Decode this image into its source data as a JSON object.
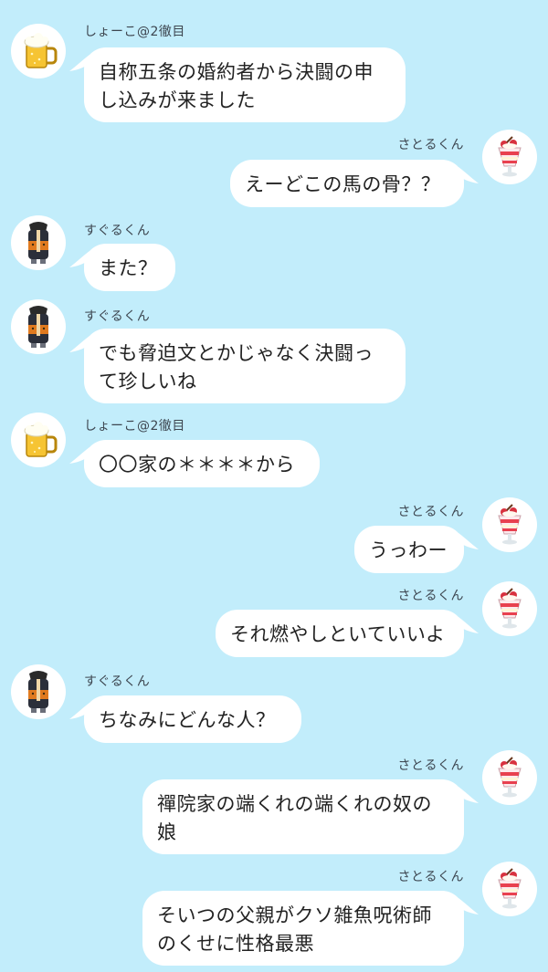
{
  "colors": {
    "background": "#c2edfb",
    "bubble": "#ffffff",
    "text": "#222222",
    "name": "#3d4650"
  },
  "users": {
    "shoko": {
      "name": "しょーこ@2徹目",
      "avatar_icon": "beer-mug-icon"
    },
    "satoru": {
      "name": "さとるくん",
      "avatar_icon": "parfait-icon"
    },
    "suguru": {
      "name": "すぐるくん",
      "avatar_icon": "monk-icon"
    }
  },
  "messages": [
    {
      "user": "shoko",
      "side": "left",
      "text": "自称五条の婚約者から決闘の申\nし込みが来ました"
    },
    {
      "user": "satoru",
      "side": "right",
      "text": "えーどこの馬の骨？？"
    },
    {
      "user": "suguru",
      "side": "left",
      "text": "また？"
    },
    {
      "user": "suguru",
      "side": "left",
      "text": "でも脅迫文とかじゃなく決闘っ\nて珍しいね"
    },
    {
      "user": "shoko",
      "side": "left",
      "text": "〇〇家の＊＊＊＊から"
    },
    {
      "user": "satoru",
      "side": "right",
      "text": "うっわー"
    },
    {
      "user": "satoru",
      "side": "right",
      "text": "それ燃やしといていいよ"
    },
    {
      "user": "suguru",
      "side": "left",
      "text": "ちなみにどんな人？"
    },
    {
      "user": "satoru",
      "side": "right",
      "text": "禪院家の端くれの端くれの奴の\n娘"
    },
    {
      "user": "satoru",
      "side": "right",
      "text": "そいつの父親がクソ雑魚呪術師\nのくせに性格最悪"
    }
  ]
}
